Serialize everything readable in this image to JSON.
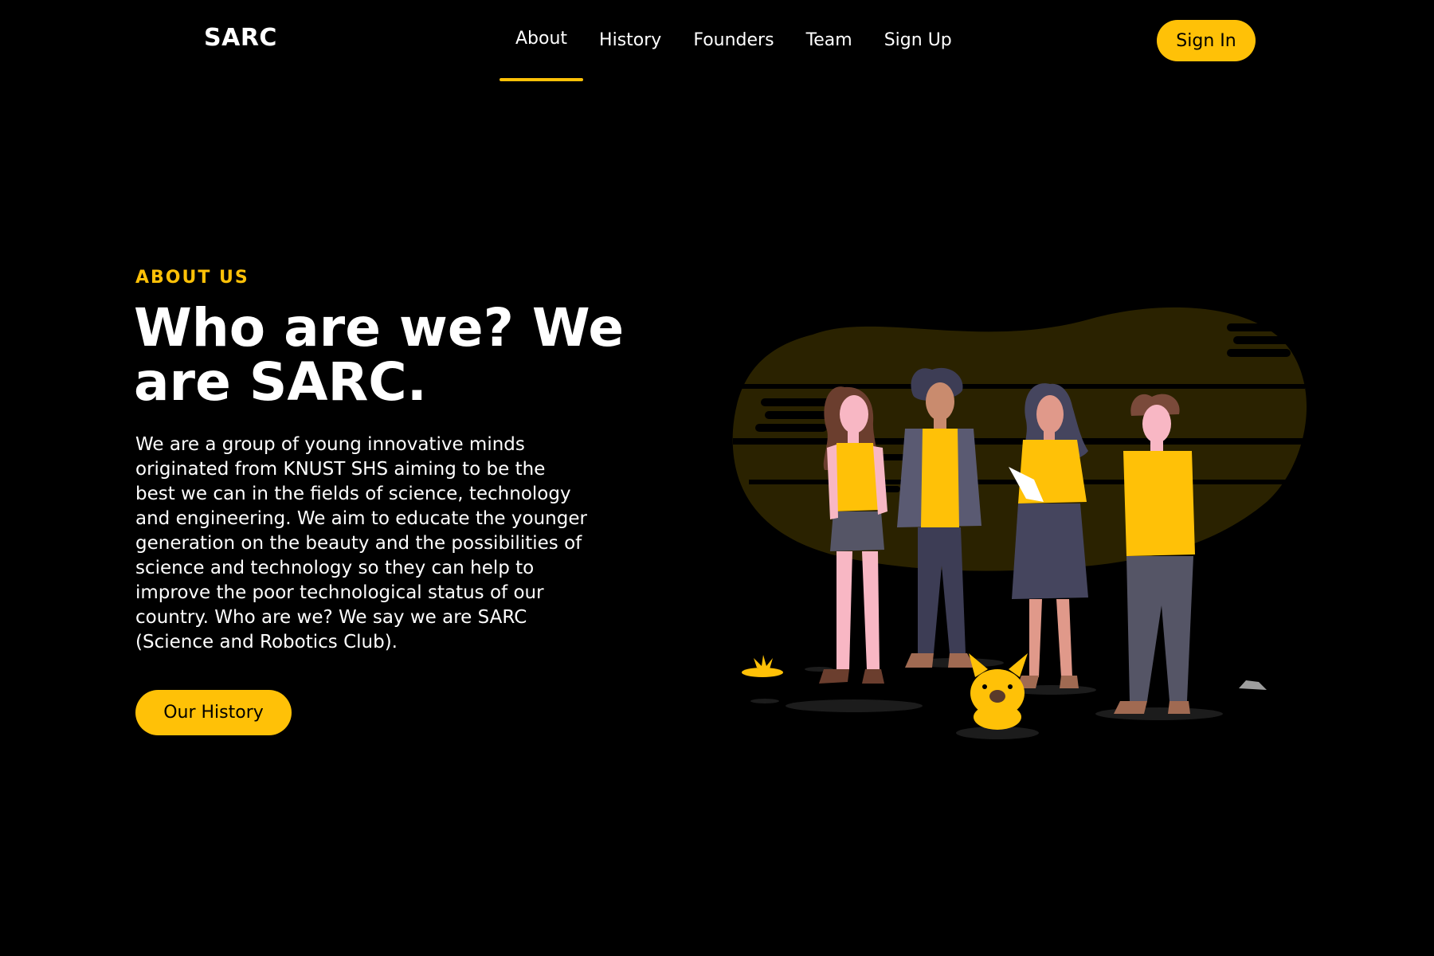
{
  "header": {
    "logo": "SARC",
    "nav": [
      {
        "label": "About",
        "active": true
      },
      {
        "label": "History",
        "active": false
      },
      {
        "label": "Founders",
        "active": false
      },
      {
        "label": "Team",
        "active": false
      },
      {
        "label": "Sign Up",
        "active": false
      }
    ],
    "signin_label": "Sign In"
  },
  "hero": {
    "eyebrow": "ABOUT US",
    "headline": "Who are we? We are SARC.",
    "description": "We are a group of young innovative minds originated from KNUST SHS aiming to be the best we can in the fields of science, technology and engineering. We aim to educate the younger generation on the beauty and the possibilities of science and technology so they can help to improve the poor technological status of our country. Who are we? We say we are SARC (Science and Robotics Club).",
    "cta_label": "Our History"
  },
  "colors": {
    "background": "#000000",
    "accent": "#FFC107",
    "text": "#FFFFFF",
    "blob": "#2A2200"
  },
  "illustration": {
    "subject": "team-of-four-people-with-dog"
  }
}
